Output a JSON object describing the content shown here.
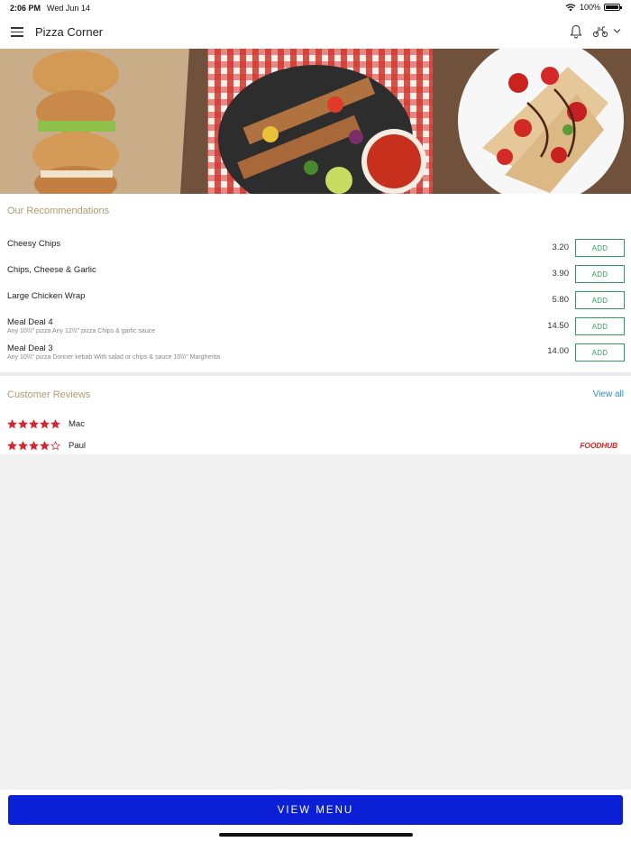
{
  "status_bar": {
    "time": "2:06 PM",
    "date": "Wed Jun 14",
    "battery": "100%"
  },
  "header": {
    "title": "Pizza Corner",
    "icons": [
      "menu-icon",
      "bell-icon",
      "scooter-icon",
      "chevron-down-icon"
    ]
  },
  "recommendations": {
    "title": "Our Recommendations",
    "add_label": "ADD",
    "items": [
      {
        "name": "Cheesy Chips",
        "desc": "",
        "price": "3.20"
      },
      {
        "name": "Chips, Cheese & Garlic",
        "desc": "",
        "price": "3.90"
      },
      {
        "name": "Large Chicken Wrap",
        "desc": "",
        "price": "5.80"
      },
      {
        "name": "Meal Deal 4",
        "desc": "Any 10\\\\\\\" pizza  Any 12\\\\\\\" pizza  Chips & garlic sauce",
        "price": "14.50"
      },
      {
        "name": "Meal Deal 3",
        "desc": "Any 10\\\\\\\" pizza  Donner kebab  With salad or chips & sauce  10\\\\\\\" Margherita",
        "price": "14.00"
      }
    ]
  },
  "reviews": {
    "title": "Customer Reviews",
    "view_all": "View all",
    "items": [
      {
        "name": "Mac",
        "rating": 5
      },
      {
        "name": "Paul",
        "rating": 4
      }
    ],
    "brand": "FOODHUB"
  },
  "footer": {
    "view_menu_label": "VIEW MENU"
  },
  "colors": {
    "accent": "#0a1fd6",
    "add_green": "#2e9e5a",
    "section_title": "#b09b70",
    "star_red": "#d6262f",
    "link_blue": "#2f8fbf"
  }
}
